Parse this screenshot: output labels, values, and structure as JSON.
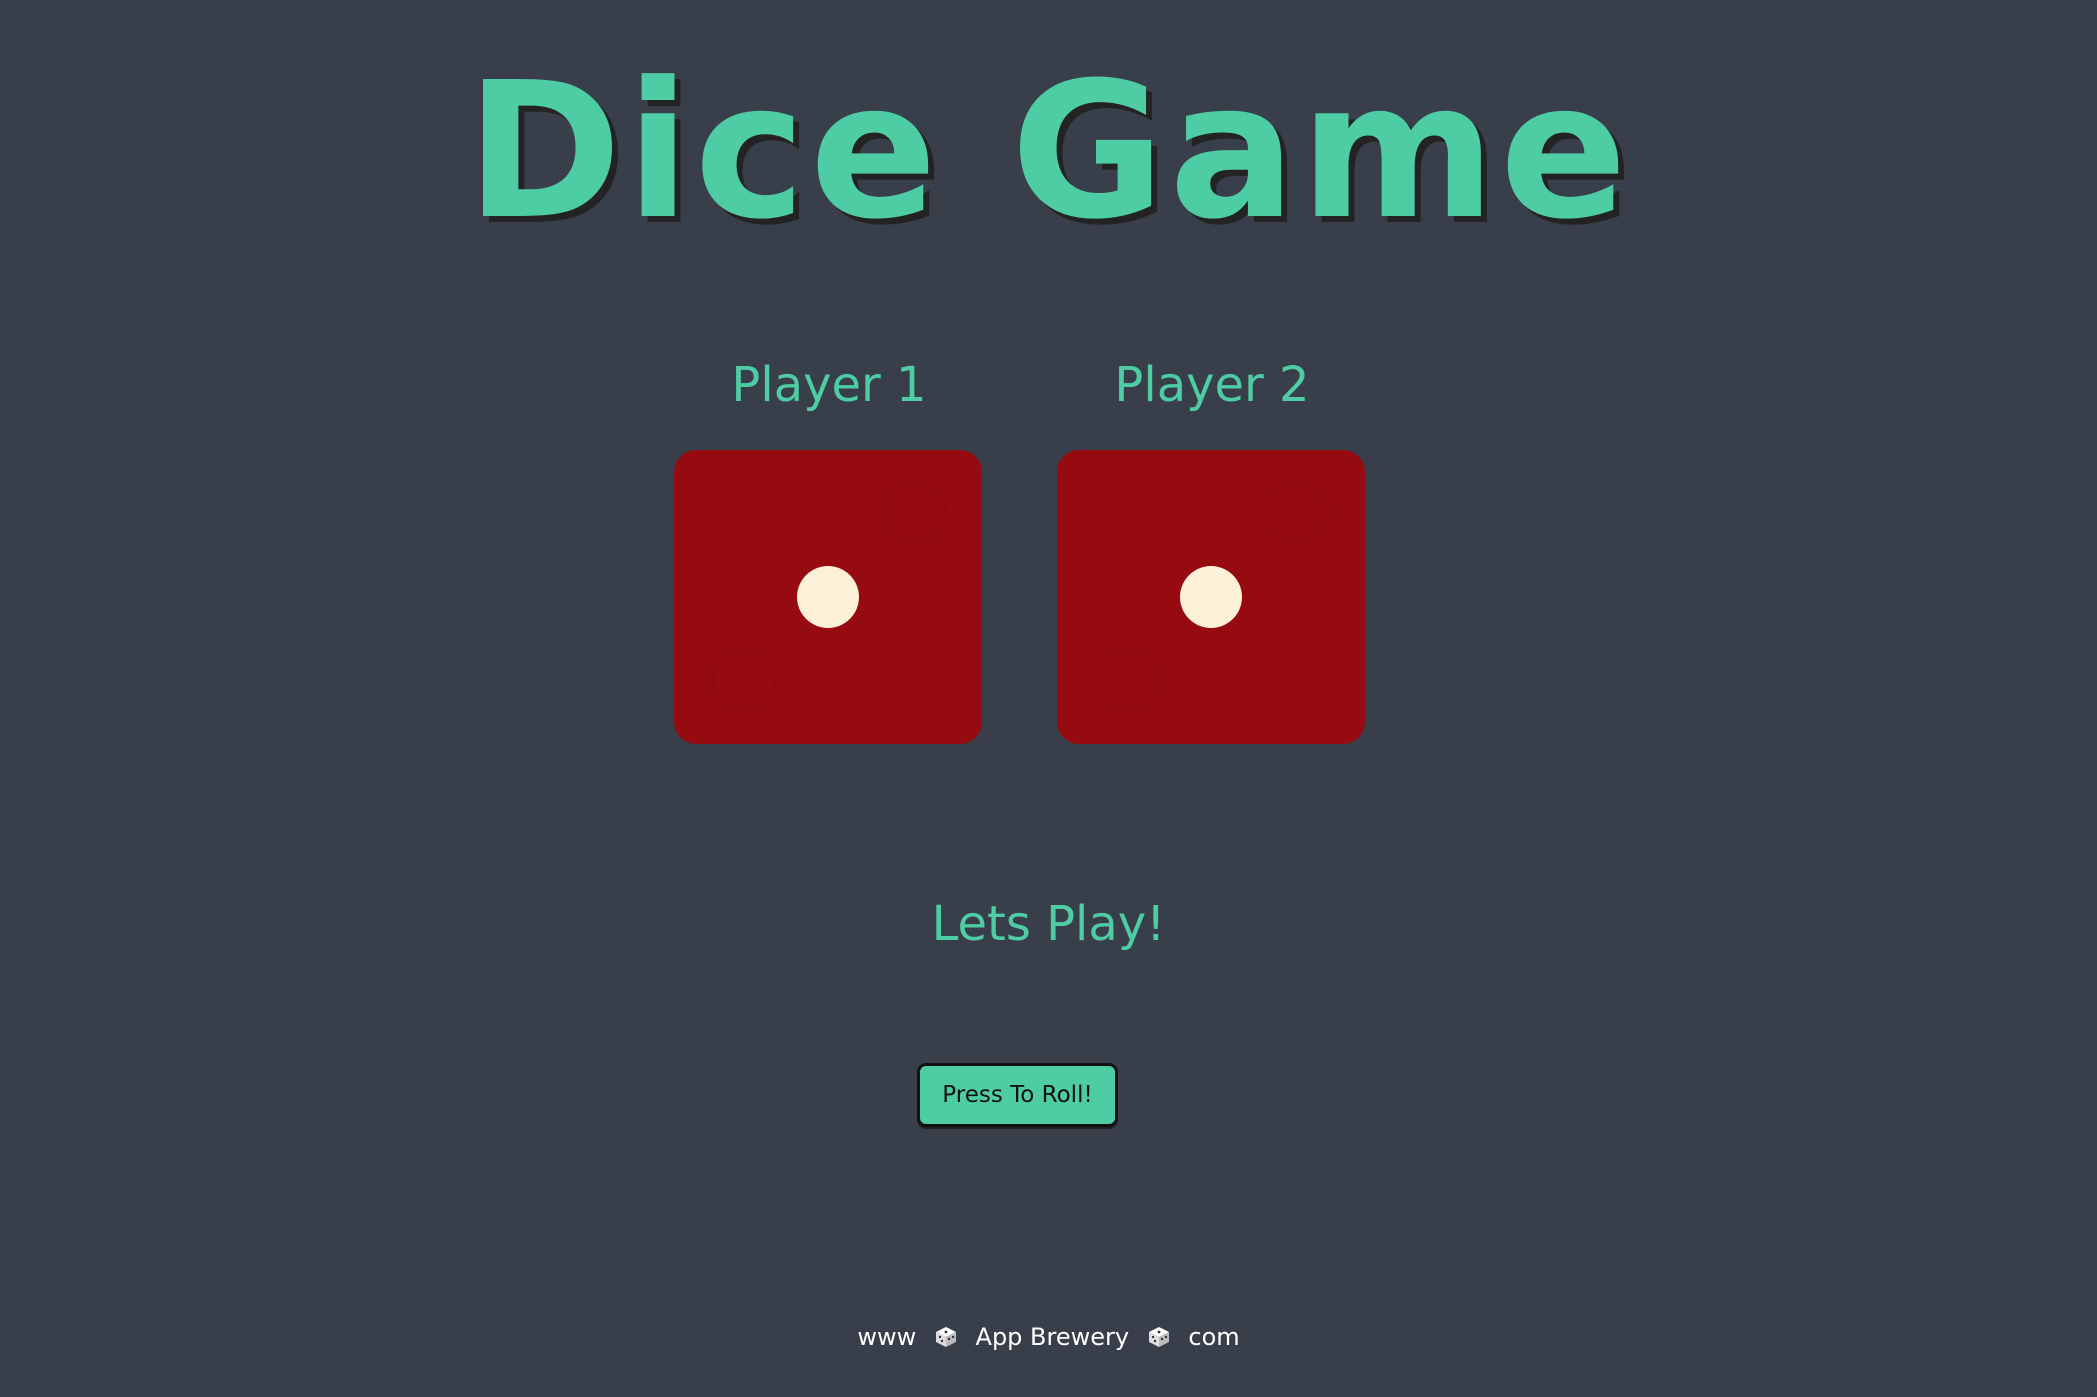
{
  "header": {
    "title": "Dice Game"
  },
  "players": [
    {
      "label": "Player 1",
      "die_value": 1
    },
    {
      "label": "Player 2",
      "die_value": 1
    }
  ],
  "status": {
    "message": "Lets Play!"
  },
  "controls": {
    "roll_label": "Press To Roll!"
  },
  "footer": {
    "parts": [
      "www",
      "App Brewery",
      "com"
    ],
    "separator_icon": "dice-icon"
  },
  "colors": {
    "background": "#393f4a",
    "accent": "#4ecca3",
    "die": "#960b0f",
    "pip": "#fdf0d8"
  }
}
